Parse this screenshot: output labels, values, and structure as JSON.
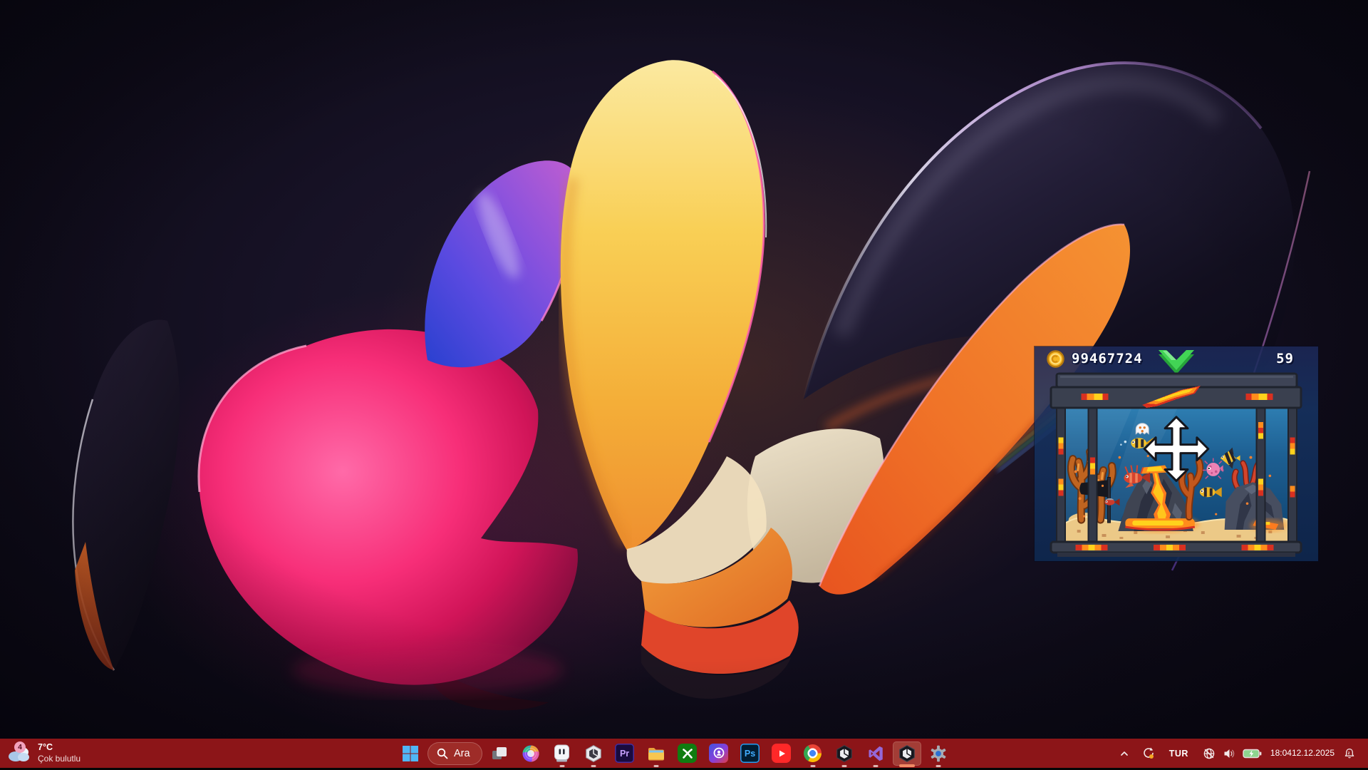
{
  "widget": {
    "coins": "99467724",
    "counter": "59"
  },
  "taskbar": {
    "weather": {
      "badge": "4",
      "temperature": "7°C",
      "condition": "Çok bulutlu"
    },
    "search": {
      "label": "Ara"
    },
    "apps": {
      "premiere_label": "Pr",
      "photoshop_label": "Ps"
    },
    "tray": {
      "language": "TUR",
      "time": "18:04",
      "date": "12.12.2025"
    }
  },
  "colors": {
    "taskbar": "#8c1518",
    "search_pill": "#9e2c28",
    "active_underline": "#f08a64",
    "running_underline": "#ddb6b4",
    "widget_background": "rgba(22,52,100,0.85)",
    "tank_frame": "#3a404f",
    "water_top": "#2f80b4",
    "water_bottom": "#134a78",
    "sand": "#ecc987",
    "lava_red": "#d83020",
    "lava_orange": "#ff8c1c",
    "lava_yellow": "#ffd21c",
    "coin_gold": "#f6b723",
    "chevron_green": "#42d455"
  }
}
